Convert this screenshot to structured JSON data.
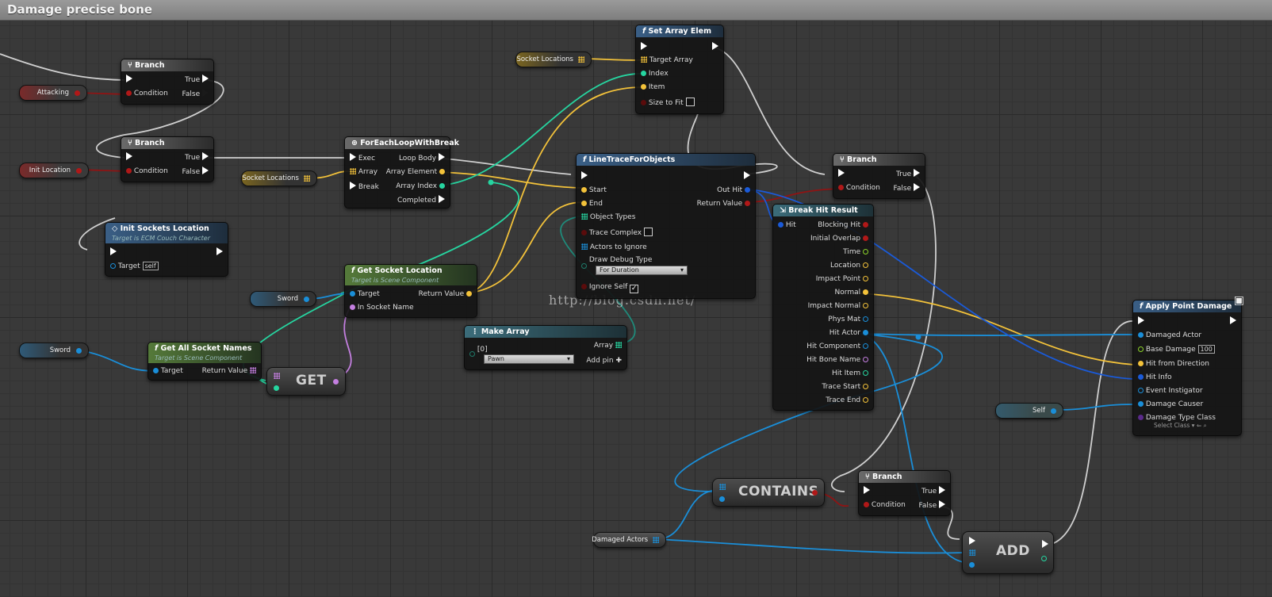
{
  "window": {
    "title": "Damage precise bone"
  },
  "watermark": "http://blog.csdn.net/",
  "colors": {
    "exec": "#ffffff",
    "bool": "#8e0f0f",
    "object": "#1a8ed8",
    "vector": "#f3c23a",
    "int": "#26d5a0",
    "struct": "#1a5ad8",
    "name": "#c47fe0",
    "float": "#8cd32a"
  },
  "vars": {
    "attacking": "Attacking",
    "init_location": "Init Location",
    "socket_locations_1": "Socket Locations",
    "socket_locations_2": "Socket Locations",
    "sword_1": "Sword",
    "sword_2": "Sword",
    "self": "Self",
    "damaged_actors": "Damaged Actors"
  },
  "nodes": {
    "branch1": {
      "title": "Branch",
      "condition": "Condition",
      "true": "True",
      "false": "False"
    },
    "branch2": {
      "title": "Branch",
      "condition": "Condition",
      "true": "True",
      "false": "False"
    },
    "branch3": {
      "title": "Branch",
      "condition": "Condition",
      "true": "True",
      "false": "False"
    },
    "branch4": {
      "title": "Branch",
      "condition": "Condition",
      "true": "True",
      "false": "False"
    },
    "init_sockets": {
      "title": "Init Sockets Location",
      "subtitle": "Target is ECM Couch Character",
      "target": "Target",
      "self_val": "self"
    },
    "foreach": {
      "title": "ForEachLoopWithBreak",
      "exec": "Exec",
      "array": "Array",
      "break": "Break",
      "loop_body": "Loop Body",
      "array_element": "Array Element",
      "array_index": "Array Index",
      "completed": "Completed"
    },
    "set_array": {
      "title": "Set Array Elem",
      "target_array": "Target Array",
      "index": "Index",
      "item": "Item",
      "size_to_fit": "Size to Fit"
    },
    "linetrace": {
      "title": "LineTraceForObjects",
      "start": "Start",
      "end": "End",
      "object_types": "Object Types",
      "trace_complex": "Trace Complex",
      "actors_to_ignore": "Actors to Ignore",
      "draw_debug_type": "Draw Debug Type",
      "draw_debug_value": "For Duration",
      "ignore_self": "Ignore Self",
      "out_hit": "Out Hit",
      "return_value": "Return Value"
    },
    "get_socket": {
      "title": "Get Socket Location",
      "subtitle": "Target is Scene Component",
      "target": "Target",
      "in_socket_name": "In Socket Name",
      "return_value": "Return Value"
    },
    "get_all_sockets": {
      "title": "Get All Socket Names",
      "subtitle": "Target is Scene Component",
      "target": "Target",
      "return_value": "Return Value"
    },
    "make_array": {
      "title": "Make Array",
      "item0": "[0]",
      "item0_value": "Pawn",
      "array": "Array",
      "add_pin": "Add pin"
    },
    "break_hit": {
      "title": "Break Hit Result",
      "hit": "Hit",
      "outputs": [
        "Blocking Hit",
        "Initial Overlap",
        "Time",
        "Location",
        "Impact Point",
        "Normal",
        "Impact Normal",
        "Phys Mat",
        "Hit Actor",
        "Hit Component",
        "Hit Bone Name",
        "Hit Item",
        "Trace Start",
        "Trace End"
      ]
    },
    "apply_damage": {
      "title": "Apply Point Damage",
      "damaged_actor": "Damaged Actor",
      "base_damage": "Base Damage",
      "base_damage_value": "100",
      "hit_from_direction": "Hit from Direction",
      "hit_info": "Hit Info",
      "event_instigator": "Event Instigator",
      "damage_causer": "Damage Causer",
      "damage_type_class": "Damage Type Class",
      "select_class": "Select Class"
    },
    "get": {
      "title": "GET"
    },
    "contains": {
      "title": "CONTAINS"
    },
    "add": {
      "title": "ADD"
    }
  }
}
